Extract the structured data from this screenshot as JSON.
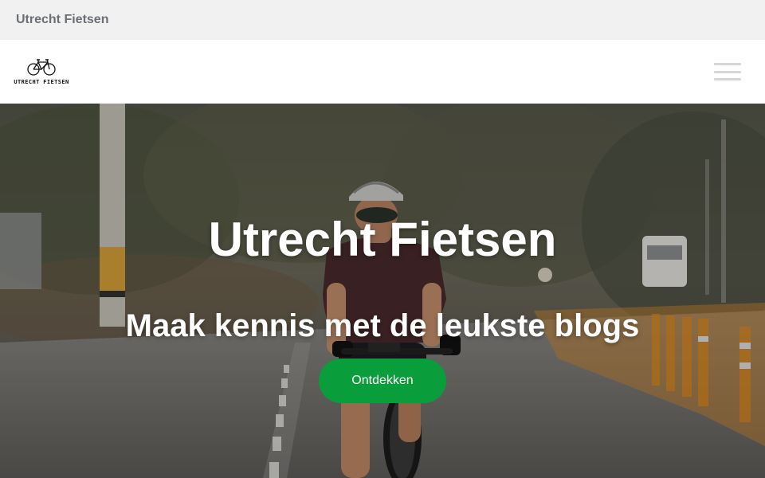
{
  "topbar": {
    "title": "Utrecht Fietsen"
  },
  "navbar": {
    "logo_text": "UTRECHT FIETSEN",
    "logo_icon": "bicycle-icon",
    "menu_icon": "hamburger-menu-icon"
  },
  "hero": {
    "title": "Utrecht Fietsen",
    "subtitle": "Maak kennis met de leukste blogs",
    "cta_label": "Ontdekken"
  },
  "colors": {
    "topbar_bg": "#f1f1f1",
    "topbar_text": "#6b6f74",
    "cta_bg": "#0a9d3b",
    "hamburger": "#d6d6d6"
  }
}
